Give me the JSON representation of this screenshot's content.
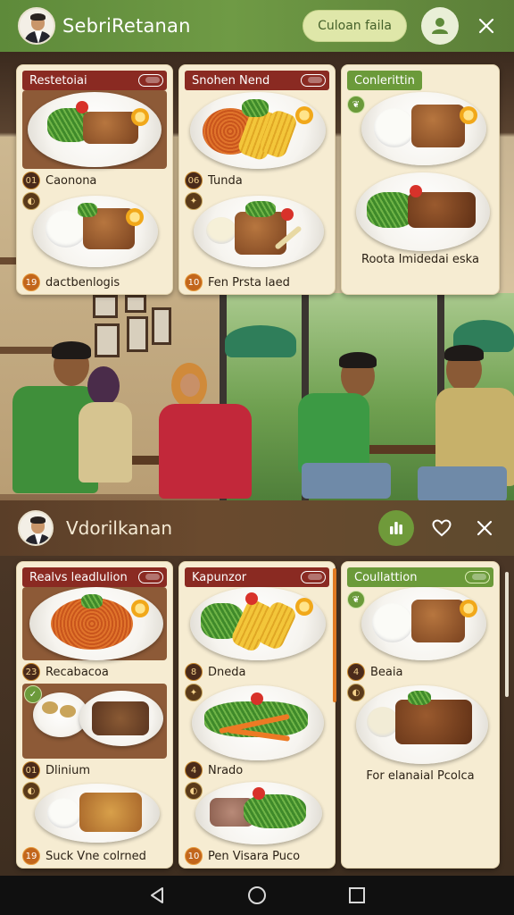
{
  "header": {
    "title": "SebriRetanan",
    "action_label": "Culoan faila",
    "accent": "#6f9a45"
  },
  "top_cards": [
    {
      "tag": "Restetoiai",
      "items": [
        "Caonona",
        "dactbenlogis"
      ],
      "nums": [
        "01",
        "19"
      ]
    },
    {
      "tag": "Snohen Nend",
      "items": [
        "Tunda",
        "Fen Prsta laed"
      ],
      "nums": [
        "06",
        "10"
      ]
    },
    {
      "tag": "Conlerittin",
      "caption": "Roota Imidedai eska"
    }
  ],
  "section": {
    "title": "Vdorilkanan"
  },
  "bottom_cards": [
    {
      "tag": "Realvs leadlulion",
      "items": [
        "Recabacoa",
        "Dlinium",
        "Suck Vne colrned"
      ],
      "nums": [
        "23",
        "01",
        "19"
      ]
    },
    {
      "tag": "Kapunzor",
      "items": [
        "Dneda",
        "Nrado",
        "Pen Visara Puco"
      ],
      "nums": [
        "8",
        "4",
        "10"
      ]
    },
    {
      "tag": "Coullattion",
      "items": [
        "Beaia"
      ],
      "nums": [
        "4"
      ],
      "caption": "For elanaial Pcolca"
    }
  ],
  "icons": {
    "top_round": "person-icon",
    "top_close": "close-icon",
    "mid_round": "bar-chart-icon",
    "mid_heart": "heart-icon",
    "mid_close": "close-icon",
    "nav": [
      "back-icon",
      "home-icon",
      "recents-icon"
    ]
  }
}
